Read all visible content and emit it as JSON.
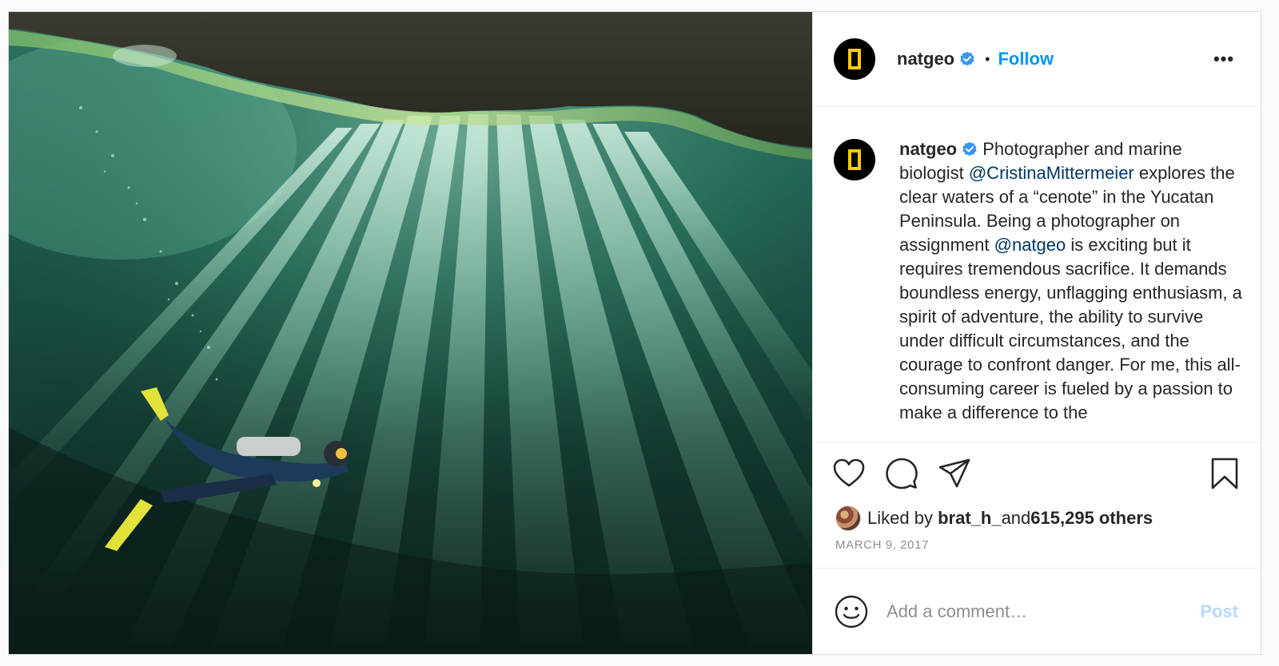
{
  "header": {
    "username": "natgeo",
    "separator": "•",
    "follow_label": "Follow",
    "more_icon": "more-horizontal-icon",
    "more_label": "•••"
  },
  "caption": {
    "username": "natgeo",
    "text_part1": "Photographer and marine biologist ",
    "mention1": "@CristinaMittermeier",
    "text_part2": " explores the clear waters of a “cenote” in the Yucatan Peninsula. Being a photographer on assignment ",
    "mention2": "@natgeo",
    "text_part3": " is exciting but it requires tremendous sacrifice. It demands boundless energy, unflagging enthusiasm, a spirit of adventure, the ability to survive under difficult circumstances, and the courage to confront danger. For me, this all-consuming career is fueled by a passion to make a difference to the"
  },
  "actions": {
    "like_icon": "heart-icon",
    "comment_icon": "comment-icon",
    "share_icon": "paper-plane-icon",
    "save_icon": "bookmark-icon"
  },
  "likes": {
    "prefix": "Liked by ",
    "user": "brat_h_",
    "middle": " and ",
    "count": "615,295 others"
  },
  "date": "MARCH 9, 2017",
  "comment": {
    "placeholder": "Add a comment…",
    "post_label": "Post",
    "emoji_icon": "smiley-icon"
  },
  "colors": {
    "follow": "#0095f6",
    "post_disabled": "#b3dbff",
    "mention": "#00376b",
    "verified": "#3897f0",
    "logo_yellow": "#ffcc00"
  }
}
